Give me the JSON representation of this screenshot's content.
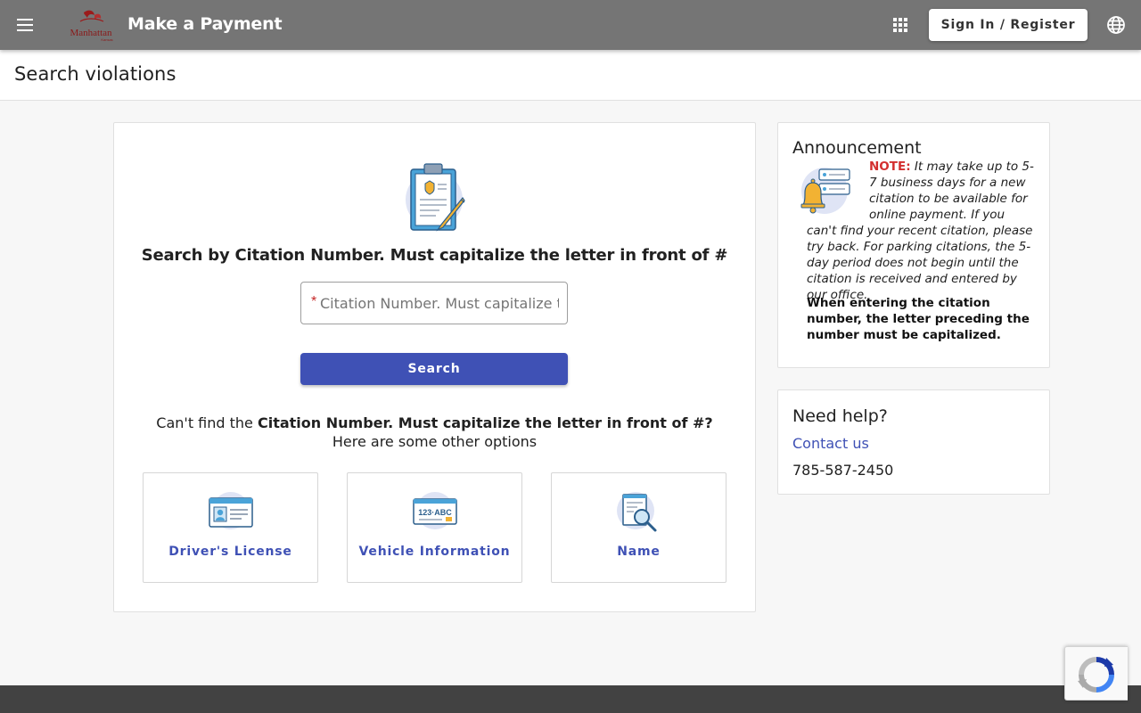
{
  "header": {
    "app_title": "Make a Payment",
    "logo_text": "Manhattan",
    "signin_label": "Sign In / Register"
  },
  "page": {
    "title": "Search violations"
  },
  "search": {
    "heading": "Search by Citation Number. Must capitalize the letter in front of #",
    "required_marker": "*",
    "placeholder": "Citation Number. Must capitalize the letter in front of #",
    "value": "",
    "button_label": "Search",
    "cant_find_prefix": "Can't find the ",
    "cant_find_field": "Citation Number. Must capitalize the letter in front of #?",
    "other_options_text": "Here are some other options"
  },
  "options": [
    {
      "label": "Driver's License",
      "icon": "drivers-license-icon"
    },
    {
      "label": "Vehicle Information",
      "icon": "license-plate-icon"
    },
    {
      "label": "Name",
      "icon": "document-search-icon"
    }
  ],
  "announcement": {
    "title": "Announcement",
    "note_label": "NOTE:",
    "note_text": " It may take up to 5-7 business days for a new citation to be available for online payment.  If you can't find your recent citation, please try back.  For parking citations, the 5-day period does not begin until the citation is received and entered by our office.",
    "bold_text": "When entering the citation number, the letter preceding the number must be capitalized."
  },
  "help": {
    "title": "Need help?",
    "contact_label": "Contact us",
    "phone": "785-587-2450"
  },
  "colors": {
    "header_bg": "#757575",
    "primary": "#3f51b5",
    "note_red": "#d32f2f",
    "footer_bg": "#424242"
  }
}
